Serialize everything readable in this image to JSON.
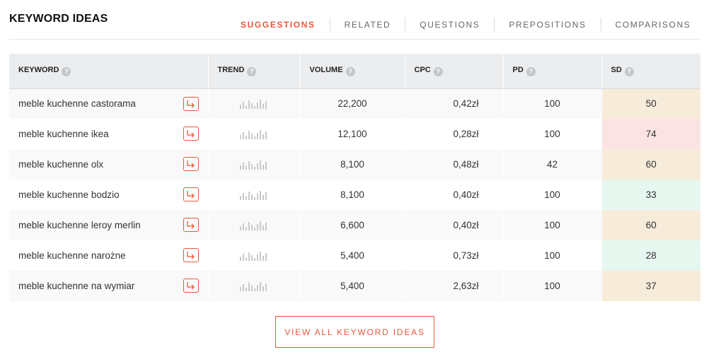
{
  "header": {
    "title": "KEYWORD IDEAS",
    "tabs": [
      {
        "label": "SUGGESTIONS",
        "active": true
      },
      {
        "label": "RELATED",
        "active": false
      },
      {
        "label": "QUESTIONS",
        "active": false
      },
      {
        "label": "PREPOSITIONS",
        "active": false
      },
      {
        "label": "COMPARISONS",
        "active": false
      }
    ]
  },
  "table": {
    "columns": [
      "KEYWORD",
      "TREND",
      "VOLUME",
      "CPC",
      "PD",
      "SD"
    ],
    "help_glyph": "?",
    "rows": [
      {
        "keyword": "meble kuchenne castorama",
        "volume": "22,200",
        "cpc": "0,42zł",
        "pd": "100",
        "sd": "50",
        "sd_color": "#f7ebda"
      },
      {
        "keyword": "meble kuchenne ikea",
        "volume": "12,100",
        "cpc": "0,28zł",
        "pd": "100",
        "sd": "74",
        "sd_color": "#fbe3e3"
      },
      {
        "keyword": "meble kuchenne olx",
        "volume": "8,100",
        "cpc": "0,48zł",
        "pd": "42",
        "sd": "60",
        "sd_color": "#f7ebda"
      },
      {
        "keyword": "meble kuchenne bodzio",
        "volume": "8,100",
        "cpc": "0,40zł",
        "pd": "100",
        "sd": "33",
        "sd_color": "#e6f7ef"
      },
      {
        "keyword": "meble kuchenne leroy merlin",
        "volume": "6,600",
        "cpc": "0,40zł",
        "pd": "100",
        "sd": "60",
        "sd_color": "#f7ebda"
      },
      {
        "keyword": "meble kuchenne narożne",
        "volume": "5,400",
        "cpc": "0,73zł",
        "pd": "100",
        "sd": "28",
        "sd_color": "#e6f7ef"
      },
      {
        "keyword": "meble kuchenne na wymiar",
        "volume": "5,400",
        "cpc": "2,63zł",
        "pd": "100",
        "sd": "37",
        "sd_color": "#f7ebda"
      }
    ]
  },
  "footer": {
    "view_all_label": "VIEW ALL KEYWORD IDEAS"
  },
  "colors": {
    "accent": "#e8583c"
  },
  "icons": {
    "goto": "arrow-right-icon",
    "help": "help-icon",
    "trend": "trend-sparkline-icon"
  }
}
